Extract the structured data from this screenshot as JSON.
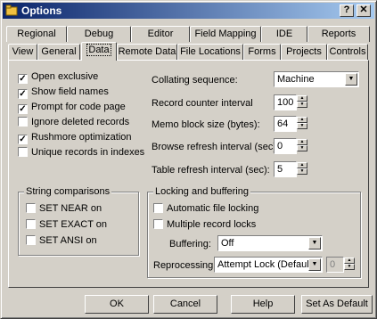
{
  "window": {
    "title": "Options",
    "close_label": "✕",
    "help_label": "?"
  },
  "tabs_row1": [
    "Regional",
    "Debug",
    "Editor",
    "Field Mapping",
    "IDE",
    "Reports"
  ],
  "tabs_row2": [
    "View",
    "General",
    "Data",
    "Remote Data",
    "File Locations",
    "Forms",
    "Projects",
    "Controls"
  ],
  "active_tab": "Data",
  "left_checks": [
    {
      "label": "Open exclusive",
      "checked": true
    },
    {
      "label": "Show field names",
      "checked": true
    },
    {
      "label": "Prompt for code page",
      "checked": true
    },
    {
      "label": "Ignore deleted records",
      "checked": false
    },
    {
      "label": "Rushmore optimization",
      "checked": true
    },
    {
      "label": "Unique records in indexes",
      "checked": false
    }
  ],
  "settings": {
    "collating_label": "Collating sequence:",
    "collating_value": "Machine",
    "record_counter_label": "Record counter interval",
    "record_counter_value": "100",
    "memo_block_label": "Memo block size (bytes):",
    "memo_block_value": "64",
    "browse_refresh_label": "Browse refresh interval (sec):",
    "browse_refresh_value": "0",
    "table_refresh_label": "Table refresh interval (sec):",
    "table_refresh_value": "5"
  },
  "string_comparisons": {
    "title": "String comparisons",
    "items": [
      {
        "label": "SET NEAR on",
        "checked": false
      },
      {
        "label": "SET EXACT on",
        "checked": false
      },
      {
        "label": "SET ANSI on",
        "checked": false
      }
    ]
  },
  "locking": {
    "title": "Locking and buffering",
    "auto_lock_label": "Automatic file locking",
    "multi_lock_label": "Multiple record locks",
    "buffering_label": "Buffering:",
    "buffering_value": "Off",
    "reprocessing_label": "Reprocessing:",
    "reprocessing_value": "Attempt Lock (Default)",
    "reprocessing_count": "0"
  },
  "buttons": {
    "ok": "OK",
    "cancel": "Cancel",
    "help": "Help",
    "set_default": "Set As Default"
  },
  "colors": {
    "title_start": "#0a246a",
    "title_end": "#a6caf0",
    "face": "#d4d0c8"
  }
}
